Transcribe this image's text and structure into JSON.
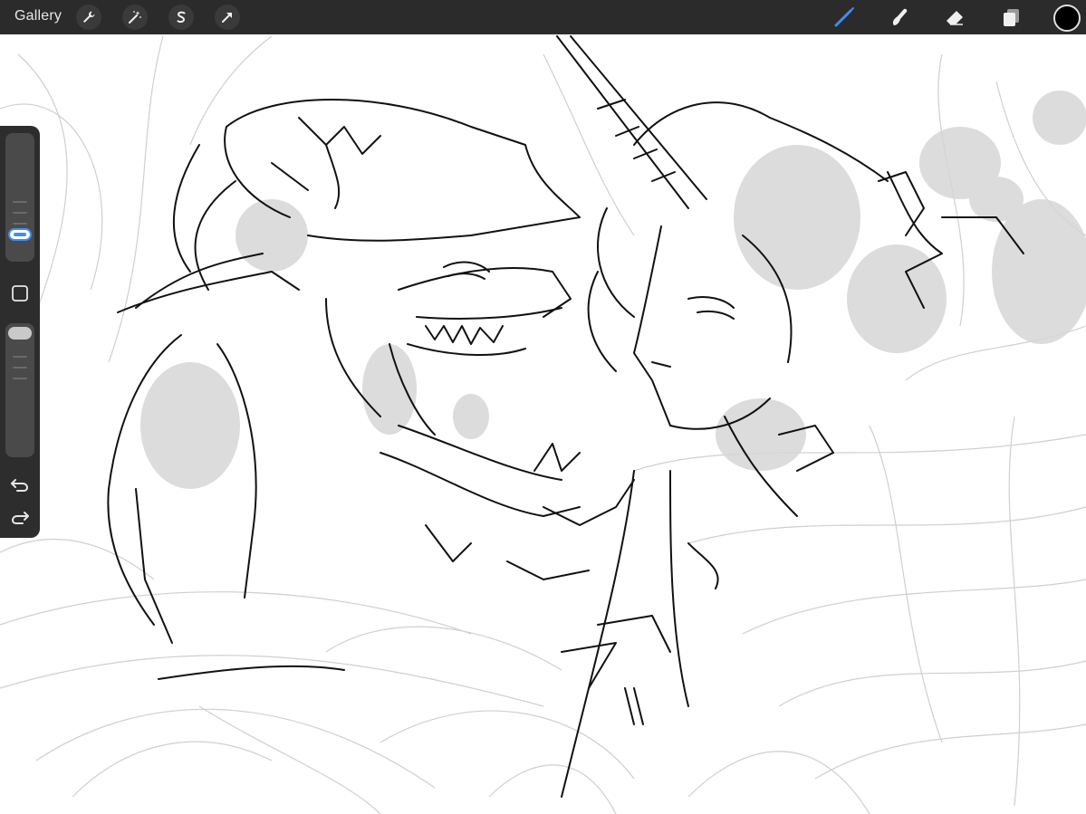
{
  "toolbar": {
    "gallery_label": "Gallery",
    "left_tools": [
      {
        "icon": "wrench-icon",
        "name": "actions"
      },
      {
        "icon": "magic-wand-icon",
        "name": "adjustments"
      },
      {
        "icon": "selection-s-icon",
        "name": "selection"
      },
      {
        "icon": "arrow-cursor-icon",
        "name": "transform"
      }
    ],
    "right_tools": [
      {
        "icon": "brush-icon",
        "name": "paint",
        "active": true
      },
      {
        "icon": "smudge-icon",
        "name": "smudge",
        "active": false
      },
      {
        "icon": "eraser-icon",
        "name": "erase",
        "active": false
      },
      {
        "icon": "layers-icon",
        "name": "layers",
        "active": false
      }
    ],
    "current_color": "#000000"
  },
  "sidebar": {
    "brush_size_level": 0.25,
    "opacity_level": 0.95,
    "modify_button_icon": "square-icon",
    "undo_icon": "undo-icon",
    "redo_icon": "redo-icon"
  },
  "colors": {
    "toolbar_bg": "#2b2b2b",
    "sidebar_bg": "#2d2d2d",
    "accent_blue": "#3d8df5",
    "canvas_bg": "#ffffff",
    "stroke": "#111111",
    "sketch_grey": "#cfcfcf",
    "shade_grey": "#d6d6d6"
  }
}
